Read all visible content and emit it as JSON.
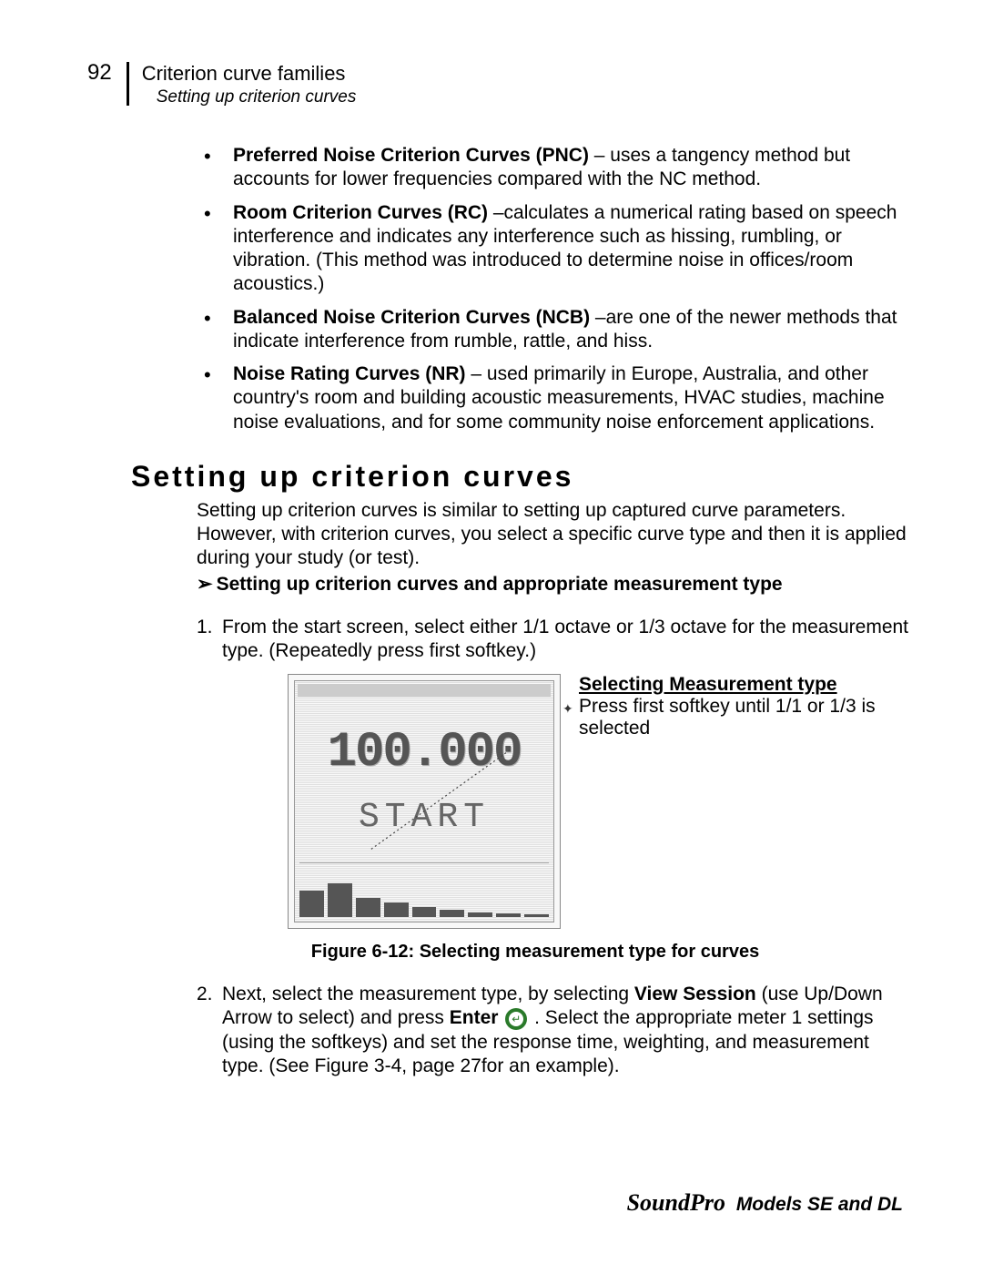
{
  "header": {
    "page_number": "92",
    "title": "Criterion curve families",
    "subtitle": "Setting up criterion curves"
  },
  "bullets": [
    {
      "strong": "Preferred Noise Criterion Curves (PNC)",
      "rest": " – uses a tangency method but accounts for lower frequencies compared with the NC method."
    },
    {
      "strong": "Room Criterion Curves (RC)",
      "rest": " –calculates a numerical rating based on speech interference and indicates any interference such as hissing, rumbling, or vibration.  (This method was introduced to determine noise in offices/room acoustics.)"
    },
    {
      "strong": "Balanced Noise Criterion Curves (NCB)",
      "rest": " –are one of the newer methods that indicate interference from rumble, rattle, and hiss."
    },
    {
      "strong": "Noise Rating Curves (NR)",
      "rest": " –  used primarily in Europe, Australia, and other country's room and building acoustic measurements, HVAC studies, machine noise evaluations, and for some community noise enforcement applications."
    }
  ],
  "section": {
    "heading": "Setting up criterion curves",
    "intro": "Setting up criterion curves is similar to setting up captured curve parameters. However, with criterion curves, you select a specific curve type and then it is applied during your study (or test).",
    "chevron_text": "Setting up criterion curves and appropriate measurement type"
  },
  "steps": {
    "step1": {
      "num": "1.",
      "text": "From the start screen, select either 1/1 octave or 1/3 octave for the measurement type. (Repeatedly press first softkey.)"
    },
    "step2": {
      "num": "2.",
      "pre": "Next, select the measurement type, by selecting ",
      "bold1": "View Session",
      "mid1": " (use Up/Down Arrow to select) and press ",
      "bold2": "Enter",
      "mid2": " .   Select the appropriate meter 1 settings (using the softkeys) and set the response time, weighting, and measurement type.  (See Figure 3-4, page 27for an example)."
    }
  },
  "device": {
    "big_number": "100.000",
    "start_label": "START"
  },
  "callout": {
    "title": "Selecting Measurement type",
    "body": "Press first softkey until 1/1 or 1/3 is selected"
  },
  "figure_caption": "Figure 6-12:  Selecting measurement type for curves",
  "footer": {
    "brand": "SoundPro",
    "models": "Models SE and DL"
  }
}
